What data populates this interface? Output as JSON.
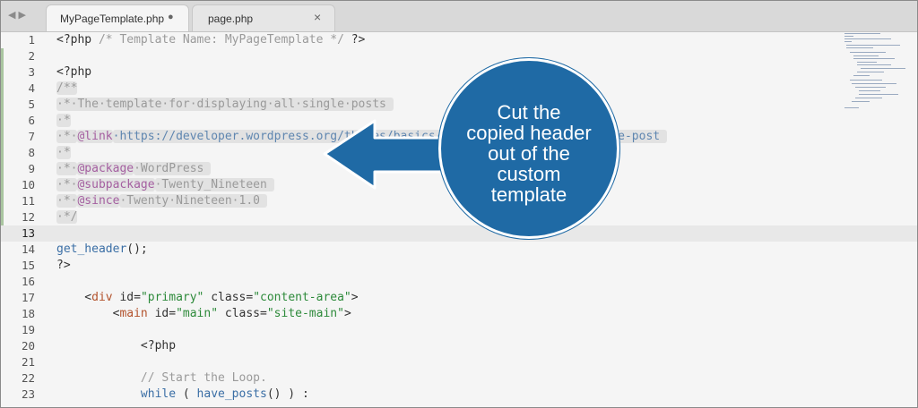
{
  "tabs": [
    {
      "label": "MyPageTemplate.php",
      "indicator": "●",
      "active": true
    },
    {
      "label": "page.php",
      "indicator": "×",
      "active": false
    }
  ],
  "nav_arrows": "◀▶",
  "lines": [
    {
      "n": "1",
      "segments": [
        {
          "t": "<?php ",
          "c": ""
        },
        {
          "t": "/* Template Name: MyPageTemplate */",
          "c": "cmt"
        },
        {
          "t": " ?>",
          "c": ""
        }
      ]
    },
    {
      "n": "2",
      "segments": []
    },
    {
      "n": "3",
      "segments": [
        {
          "t": "<?php",
          "c": ""
        }
      ]
    },
    {
      "n": "4",
      "segments": [
        {
          "t": "/**",
          "c": "cmt sel"
        }
      ]
    },
    {
      "n": "5",
      "segments": [
        {
          "t": "·*·The·template·for·displaying·all·single·posts ",
          "c": "cmt sel"
        }
      ]
    },
    {
      "n": "6",
      "segments": [
        {
          "t": "·*",
          "c": "cmt sel"
        }
      ]
    },
    {
      "n": "7",
      "segments": [
        {
          "t": "·*·",
          "c": "cmt sel"
        },
        {
          "t": "@link",
          "c": "kw sel"
        },
        {
          "t": "·https://developer.wordpress.org/themes/basics/template-hierarchy/#single-post ",
          "c": "lnk sel"
        }
      ]
    },
    {
      "n": "8",
      "segments": [
        {
          "t": "·*",
          "c": "cmt sel"
        }
      ]
    },
    {
      "n": "9",
      "segments": [
        {
          "t": "·*·",
          "c": "cmt sel"
        },
        {
          "t": "@package",
          "c": "kw sel"
        },
        {
          "t": "·WordPress ",
          "c": "cmt sel"
        }
      ]
    },
    {
      "n": "10",
      "segments": [
        {
          "t": "·*·",
          "c": "cmt sel"
        },
        {
          "t": "@subpackage",
          "c": "kw sel"
        },
        {
          "t": "·Twenty_Nineteen ",
          "c": "cmt sel"
        }
      ]
    },
    {
      "n": "11",
      "segments": [
        {
          "t": "·*·",
          "c": "cmt sel"
        },
        {
          "t": "@since",
          "c": "kw sel"
        },
        {
          "t": "·Twenty·Nineteen·1.0 ",
          "c": "cmt sel"
        }
      ]
    },
    {
      "n": "12",
      "segments": [
        {
          "t": "·*/",
          "c": "cmt sel"
        }
      ]
    },
    {
      "n": "13",
      "segments": []
    },
    {
      "n": "14",
      "segments": [
        {
          "t": "get_header",
          "c": "fn"
        },
        {
          "t": "();",
          "c": ""
        }
      ]
    },
    {
      "n": "15",
      "segments": [
        {
          "t": "?>",
          "c": ""
        }
      ]
    },
    {
      "n": "16",
      "segments": []
    },
    {
      "n": "17",
      "segments": [
        {
          "t": "    <",
          "c": ""
        },
        {
          "t": "div",
          "c": "tag"
        },
        {
          "t": " id=",
          "c": ""
        },
        {
          "t": "\"primary\"",
          "c": "str"
        },
        {
          "t": " class=",
          "c": ""
        },
        {
          "t": "\"content-area\"",
          "c": "str"
        },
        {
          "t": ">",
          "c": ""
        }
      ]
    },
    {
      "n": "18",
      "segments": [
        {
          "t": "        <",
          "c": ""
        },
        {
          "t": "main",
          "c": "tag"
        },
        {
          "t": " id=",
          "c": ""
        },
        {
          "t": "\"main\"",
          "c": "str"
        },
        {
          "t": " class=",
          "c": ""
        },
        {
          "t": "\"site-main\"",
          "c": "str"
        },
        {
          "t": ">",
          "c": ""
        }
      ]
    },
    {
      "n": "19",
      "segments": []
    },
    {
      "n": "20",
      "segments": [
        {
          "t": "            <?php",
          "c": ""
        }
      ]
    },
    {
      "n": "21",
      "segments": []
    },
    {
      "n": "22",
      "segments": [
        {
          "t": "            // Start the Loop.",
          "c": "cmt"
        }
      ]
    },
    {
      "n": "23",
      "segments": [
        {
          "t": "            ",
          "c": ""
        },
        {
          "t": "while",
          "c": "fn"
        },
        {
          "t": " ( ",
          "c": ""
        },
        {
          "t": "have_posts",
          "c": "fn"
        },
        {
          "t": "() ) :",
          "c": ""
        }
      ]
    }
  ],
  "callout": {
    "text_lines": [
      "Cut the",
      "copied header",
      "out of the",
      "custom",
      "template"
    ]
  },
  "colors": {
    "callout": "#1f6aa5",
    "comment": "#9a9a9a",
    "keyword": "#a45fa0",
    "string": "#2d8a3a",
    "tag": "#b3532d"
  }
}
